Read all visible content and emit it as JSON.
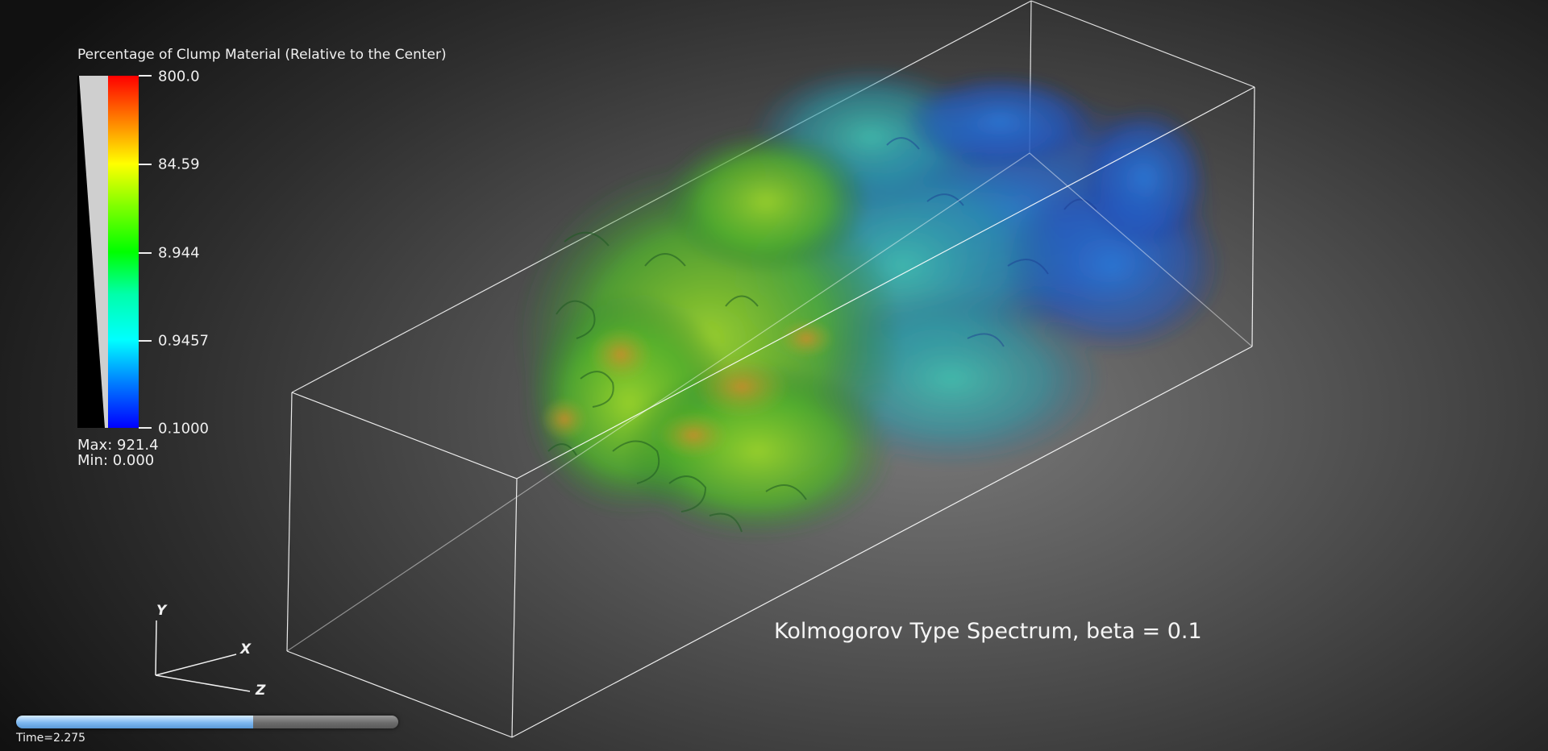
{
  "legend": {
    "title": "Percentage of Clump Material (Relative to the Center)",
    "ticks": [
      "800.0",
      "84.59",
      "8.944",
      "0.9457",
      "0.1000"
    ],
    "max_label": "Max:  921.4",
    "min_label": "Min:  0.000"
  },
  "annotation": "Kolmogorov Type Spectrum, beta = 0.1",
  "axes": {
    "x": "X",
    "y": "Y",
    "z": "Z"
  },
  "time": {
    "label": "Time=2.275",
    "progress": 0.62
  },
  "colors": {
    "colormap": [
      "#0000ff",
      "#00ffff",
      "#00ff00",
      "#ffff00",
      "#ff0000"
    ],
    "bounding_box": "#ffffff"
  }
}
